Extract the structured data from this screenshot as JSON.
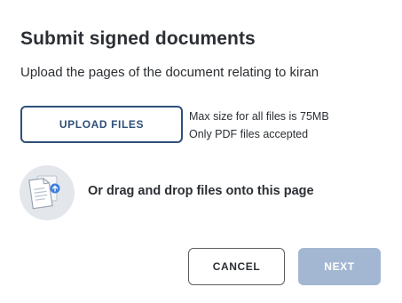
{
  "dialog": {
    "title": "Submit signed documents",
    "subtitle": "Upload the pages of the document relating to kiran"
  },
  "upload": {
    "button_label": "UPLOAD FILES",
    "max_size_text": "Max size for all files is 75MB",
    "accepted_text": "Only PDF files accepted"
  },
  "drop_zone": {
    "icon": "document-upload-icon",
    "text": "Or drag and drop files onto this page"
  },
  "actions": {
    "cancel_label": "CANCEL",
    "next_label": "NEXT",
    "next_enabled": false
  },
  "colors": {
    "primary": "#2f4f78",
    "next_disabled_bg": "#a3b7d3",
    "icon_circle": "#e3e7ec",
    "icon_accent": "#3d7fe0"
  }
}
